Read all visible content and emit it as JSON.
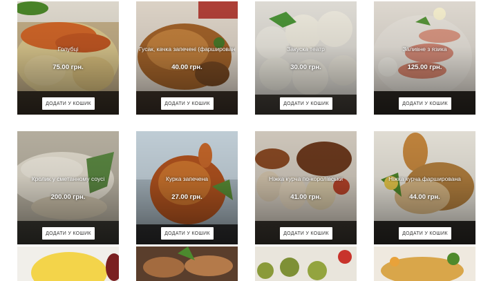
{
  "products": [
    {
      "title": "Голубці",
      "price": "75.00 грн.",
      "button": "ДОДАТИ У КОШИК"
    },
    {
      "title": "Гусак, качка запечені (фаршировані)",
      "price": "40.00 грн.",
      "button": "ДОДАТИ У КОШИК"
    },
    {
      "title": "Закуска театр",
      "price": "30.00 грн.",
      "button": "ДОДАТИ У КОШИК"
    },
    {
      "title": "Заливне з язика",
      "price": "125.00 грн.",
      "button": "ДОДАТИ У КОШИК"
    },
    {
      "title": "Кролик у сметанному соусі",
      "price": "200.00 грн.",
      "button": "ДОДАТИ У КОШИК"
    },
    {
      "title": "Курка запечена",
      "price": "27.00 грн.",
      "button": "ДОДАТИ У КОШИК"
    },
    {
      "title": "Ніжка курча по-королівськи",
      "price": "41.00 грн.",
      "button": "ДОДАТИ У КОШИК"
    },
    {
      "title": "Ніжка курча фарширована",
      "price": "44.00 грн.",
      "button": "ДОДАТИ У КОШИК"
    }
  ]
}
